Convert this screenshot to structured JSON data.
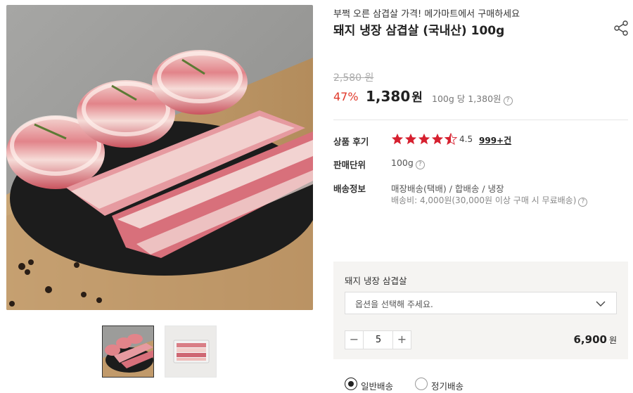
{
  "product": {
    "promo_text": "부쩍 오른 삼겹살 가격! 메가마트에서 구매하세요",
    "title": "돼지 냉장 삼겹살 (국내산) 100g",
    "original_price": "2,580 원",
    "discount": "47%",
    "price": "1,380",
    "price_unit": "원",
    "unit_price": "100g 당 1,380원",
    "image_alt": "돼지 냉장 삼겹살"
  },
  "info_rows": {
    "review_label": "상품 후기",
    "rating": 4.5,
    "rating_text": "4.5",
    "review_count": "999+건",
    "sale_unit_label": "판매단위",
    "sale_unit_value": "100g",
    "shipping_label": "배송정보",
    "shipping_method": "매장배송(택배) / 합배송 / 냉장",
    "shipping_fee": "배송비: 4,000원(30,000원 이상 구매 시 무료배송)"
  },
  "option_box": {
    "option_name": "돼지 냉장 삼겹살",
    "select_placeholder": "옵션을 선택해 주세요.",
    "quantity": "5",
    "total_price": "6,900",
    "total_unit": "원"
  },
  "delivery": {
    "options": [
      {
        "label": "일반배송",
        "selected": true
      },
      {
        "label": "정기배송",
        "selected": false
      }
    ]
  },
  "icons": {
    "share": "share-icon",
    "info": "info-icon",
    "star": "star-icon",
    "chevron": "chevron-down-icon",
    "minus": "minus-icon",
    "plus": "plus-icon"
  },
  "colors": {
    "discount": "#e0392b",
    "star": "#d6202f",
    "option_box_bg": "#f5f4f2"
  }
}
